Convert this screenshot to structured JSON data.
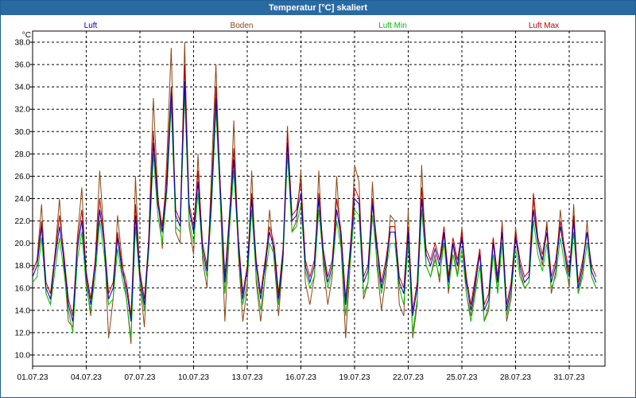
{
  "window": {
    "title": "Temperatur [°C] skaliert"
  },
  "chart_data": {
    "type": "line",
    "title": "Temperatur [°C] skaliert",
    "ylabel": "°C",
    "xlabel": "",
    "ylim": [
      9,
      39
    ],
    "xlim": [
      0,
      32
    ],
    "grid": true,
    "yticks": [
      10,
      12,
      14,
      16,
      18,
      20,
      22,
      24,
      26,
      28,
      30,
      32,
      34,
      36,
      38
    ],
    "ytick_labels": [
      "10.0",
      "12.0",
      "14.0",
      "16.0",
      "18.0",
      "20.0",
      "22.0",
      "24.0",
      "26.0",
      "28.0",
      "30.0",
      "32.0",
      "34.0",
      "36.0",
      "38.0"
    ],
    "xticks": [
      0,
      3,
      6,
      9,
      12,
      15,
      18,
      21,
      24,
      27,
      30
    ],
    "xtick_labels": [
      "01.07.23",
      "04.07.23",
      "07.07.23",
      "10.07.23",
      "13.07.23",
      "16.07.23",
      "19.07.23",
      "22.07.23",
      "25.07.23",
      "28.07.23",
      "31.07.23"
    ],
    "series_time": [
      0,
      0.25,
      0.5,
      0.75,
      1,
      1.25,
      1.5,
      1.75,
      2,
      2.25,
      2.5,
      2.75,
      3,
      3.25,
      3.5,
      3.75,
      4,
      4.25,
      4.5,
      4.75,
      5,
      5.25,
      5.5,
      5.75,
      6,
      6.25,
      6.5,
      6.75,
      7,
      7.25,
      7.5,
      7.75,
      8,
      8.25,
      8.5,
      8.75,
      9,
      9.25,
      9.5,
      9.75,
      10,
      10.25,
      10.5,
      10.75,
      11,
      11.25,
      11.5,
      11.75,
      12,
      12.25,
      12.5,
      12.75,
      13,
      13.25,
      13.5,
      13.75,
      14,
      14.25,
      14.5,
      14.75,
      15,
      15.25,
      15.5,
      15.75,
      16,
      16.25,
      16.5,
      16.75,
      17,
      17.25,
      17.5,
      17.75,
      18,
      18.25,
      18.5,
      18.75,
      19,
      19.25,
      19.5,
      19.75,
      20,
      20.25,
      20.5,
      20.75,
      21,
      21.25,
      21.5,
      21.75,
      22,
      22.25,
      22.5,
      22.75,
      23,
      23.25,
      23.5,
      23.75,
      24,
      24.25,
      24.5,
      24.75,
      25,
      25.25,
      25.5,
      25.75,
      26,
      26.25,
      26.5,
      26.75,
      27,
      27.25,
      27.5,
      27.75,
      28,
      28.25,
      28.5,
      28.75,
      29,
      29.25,
      29.5,
      29.75,
      30,
      30.25,
      30.5,
      30.75,
      31,
      31.25,
      31.5,
      31.75,
      32
    ],
    "series": [
      {
        "name": "Luft",
        "color": "#0000c0",
        "values": [
          17.0,
          18.0,
          21.5,
          16.0,
          15.0,
          18.5,
          21.5,
          18.5,
          14.5,
          13.0,
          19.5,
          22.0,
          17.0,
          14.5,
          18.0,
          23.0,
          20.0,
          15.0,
          16.0,
          20.5,
          17.5,
          16.0,
          13.0,
          22.5,
          17.0,
          14.5,
          20.0,
          29.0,
          23.5,
          21.0,
          25.0,
          33.5,
          22.5,
          21.5,
          34.5,
          23.0,
          21.0,
          25.5,
          19.5,
          17.5,
          24.0,
          33.0,
          24.5,
          16.5,
          22.0,
          27.5,
          20.0,
          15.0,
          17.5,
          24.0,
          18.0,
          15.0,
          18.0,
          21.0,
          19.5,
          15.0,
          19.0,
          29.0,
          22.0,
          22.5,
          24.5,
          18.0,
          16.5,
          18.0,
          24.0,
          19.0,
          16.5,
          18.0,
          23.0,
          20.5,
          14.5,
          19.0,
          24.0,
          23.5,
          16.5,
          17.5,
          23.5,
          19.5,
          16.0,
          18.0,
          21.0,
          21.0,
          16.5,
          15.5,
          21.0,
          13.5,
          16.0,
          24.0,
          19.0,
          18.0,
          19.5,
          18.0,
          21.0,
          16.5,
          20.0,
          18.0,
          20.5,
          16.5,
          14.0,
          16.5,
          19.0,
          14.0,
          15.0,
          20.0,
          16.5,
          21.0,
          14.0,
          16.0,
          20.5,
          18.0,
          16.5,
          17.0,
          23.0,
          20.0,
          18.5,
          21.0,
          16.5,
          18.0,
          21.5,
          19.0,
          17.0,
          22.0,
          16.0,
          18.0,
          21.0,
          17.5,
          16.5
        ]
      },
      {
        "name": "Boden",
        "color": "#8b4513",
        "values": [
          17.5,
          18.5,
          23.5,
          15.5,
          14.5,
          19.0,
          24.0,
          18.0,
          13.0,
          12.5,
          20.5,
          25.0,
          16.5,
          13.5,
          18.5,
          26.5,
          20.5,
          11.5,
          15.0,
          22.5,
          18.5,
          15.0,
          11.0,
          26.0,
          16.5,
          12.5,
          21.0,
          33.0,
          24.5,
          19.5,
          27.5,
          37.5,
          21.0,
          20.0,
          38.0,
          21.5,
          19.0,
          28.0,
          18.5,
          16.0,
          26.5,
          36.0,
          23.5,
          13.0,
          21.0,
          31.0,
          19.0,
          13.0,
          16.0,
          26.5,
          16.5,
          13.0,
          17.0,
          23.0,
          18.5,
          13.5,
          18.5,
          30.5,
          21.0,
          22.0,
          26.5,
          16.5,
          14.5,
          17.0,
          26.5,
          18.0,
          14.5,
          17.0,
          26.0,
          19.5,
          11.5,
          18.0,
          27.0,
          25.5,
          15.0,
          16.5,
          25.5,
          18.0,
          14.0,
          17.0,
          22.5,
          22.0,
          14.5,
          13.5,
          23.0,
          11.5,
          14.5,
          27.0,
          18.0,
          17.0,
          19.0,
          16.5,
          21.0,
          15.5,
          20.0,
          17.0,
          21.5,
          15.5,
          13.5,
          16.0,
          19.5,
          13.0,
          14.0,
          20.5,
          15.5,
          22.0,
          13.0,
          15.0,
          21.5,
          17.5,
          16.0,
          16.5,
          24.0,
          20.0,
          18.0,
          22.0,
          15.5,
          17.5,
          23.0,
          19.0,
          16.0,
          23.5,
          15.5,
          17.5,
          22.0,
          17.0,
          16.0
        ]
      },
      {
        "name": "Luft Min",
        "color": "#00c000",
        "values": [
          16.5,
          17.0,
          20.5,
          15.5,
          14.5,
          17.5,
          20.5,
          17.5,
          14.0,
          12.0,
          18.5,
          21.0,
          16.0,
          14.0,
          17.0,
          22.0,
          19.0,
          14.5,
          15.0,
          19.5,
          17.0,
          15.0,
          11.5,
          21.5,
          16.5,
          14.0,
          19.5,
          28.0,
          22.5,
          20.0,
          24.5,
          32.5,
          21.5,
          21.0,
          33.5,
          22.0,
          20.0,
          24.5,
          19.0,
          17.0,
          23.0,
          32.0,
          23.5,
          15.5,
          21.0,
          26.5,
          19.5,
          14.5,
          16.5,
          23.0,
          17.0,
          14.0,
          17.0,
          20.0,
          19.0,
          14.5,
          18.5,
          28.0,
          21.0,
          21.5,
          23.5,
          17.5,
          16.0,
          17.0,
          23.0,
          18.5,
          16.0,
          17.5,
          22.0,
          19.5,
          13.5,
          18.0,
          23.0,
          22.5,
          15.5,
          16.5,
          22.5,
          18.5,
          15.5,
          17.5,
          20.0,
          20.0,
          16.0,
          14.5,
          20.0,
          12.0,
          15.0,
          23.0,
          18.0,
          17.0,
          18.5,
          17.0,
          20.0,
          16.0,
          19.0,
          17.0,
          19.5,
          15.5,
          13.0,
          15.5,
          18.0,
          13.0,
          14.5,
          19.0,
          15.5,
          20.0,
          13.5,
          15.5,
          19.5,
          17.0,
          16.0,
          16.5,
          22.0,
          19.0,
          17.5,
          20.0,
          16.0,
          17.0,
          20.5,
          18.0,
          16.5,
          21.0,
          15.5,
          17.0,
          20.0,
          17.0,
          16.0
        ]
      },
      {
        "name": "Luft Max",
        "color": "#c00000",
        "values": [
          17.5,
          18.5,
          22.0,
          16.5,
          15.5,
          19.0,
          22.5,
          19.0,
          15.0,
          13.5,
          20.0,
          23.0,
          17.5,
          15.0,
          18.5,
          24.0,
          20.5,
          15.5,
          16.5,
          21.0,
          18.0,
          16.5,
          13.5,
          23.5,
          17.5,
          15.0,
          20.5,
          30.0,
          24.0,
          21.5,
          26.0,
          34.0,
          23.0,
          22.0,
          36.0,
          23.5,
          21.5,
          26.5,
          20.0,
          18.0,
          24.5,
          34.0,
          25.0,
          17.0,
          22.5,
          28.5,
          20.5,
          15.5,
          18.0,
          24.5,
          18.5,
          15.5,
          18.5,
          21.5,
          20.0,
          15.5,
          19.5,
          30.0,
          22.5,
          23.0,
          25.5,
          18.5,
          17.0,
          18.5,
          24.5,
          19.5,
          17.0,
          18.5,
          24.0,
          21.0,
          15.0,
          19.5,
          25.0,
          24.0,
          17.0,
          18.0,
          24.0,
          20.0,
          16.5,
          18.5,
          21.5,
          21.5,
          17.0,
          16.0,
          21.5,
          14.0,
          16.5,
          25.0,
          19.5,
          18.5,
          20.0,
          18.5,
          21.5,
          17.0,
          20.5,
          18.5,
          21.0,
          17.0,
          14.5,
          17.0,
          19.5,
          14.5,
          15.5,
          20.5,
          17.0,
          21.5,
          14.5,
          16.5,
          21.0,
          18.5,
          17.0,
          17.5,
          24.5,
          20.5,
          19.0,
          21.5,
          17.0,
          18.5,
          22.0,
          19.5,
          17.5,
          22.5,
          16.5,
          18.5,
          21.0,
          18.0,
          17.0
        ]
      }
    ],
    "legend_placement": "top"
  }
}
